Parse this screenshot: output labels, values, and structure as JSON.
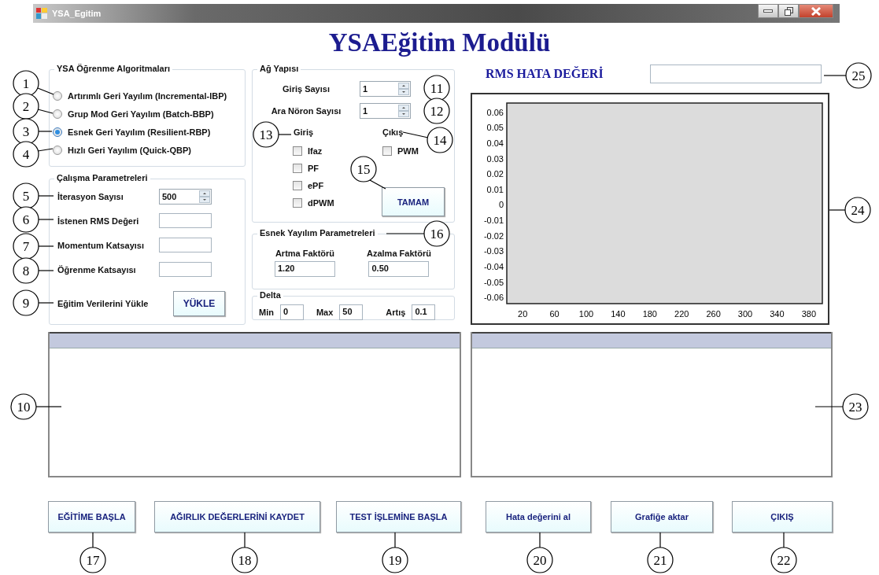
{
  "window": {
    "title": "YSA_Egitim"
  },
  "heading": "YSAEğitim Modülü",
  "algorithms": {
    "title": "YSA Öğrenme Algoritmaları",
    "options": [
      {
        "label": "Artırımlı Geri Yayılım (Incremental-IBP)",
        "selected": false
      },
      {
        "label": "Grup Mod Geri Yayılım (Batch-BBP)",
        "selected": false
      },
      {
        "label": "Esnek Geri Yayılım (Resilient-RBP)",
        "selected": true
      },
      {
        "label": "Hızlı Geri Yayılım (Quick-QBP)",
        "selected": false
      }
    ]
  },
  "parameters": {
    "title": "Çalışma Parametreleri",
    "rows": [
      {
        "kind": "spin",
        "label": "İterasyon Sayısı",
        "value": "500"
      },
      {
        "kind": "field",
        "label": "İstenen RMS Değeri"
      },
      {
        "kind": "field",
        "label": "Momentum Katsayısı"
      },
      {
        "kind": "field",
        "label": "Öğrenme Katsayısı"
      },
      {
        "kind": "button",
        "label": "Eğitim Verilerini Yükle",
        "button": "YÜKLE"
      }
    ]
  },
  "network": {
    "title": "Ağ Yapısı",
    "spins": [
      {
        "label": "Giriş Sayısı",
        "value": "1"
      },
      {
        "label": "Ara Nöron Sayısı",
        "value": "1"
      }
    ],
    "inputs": {
      "title": "Giriş",
      "options": [
        {
          "label": "Ifaz",
          "checked": false
        },
        {
          "label": "PF",
          "checked": false
        },
        {
          "label": "ePF",
          "checked": false
        },
        {
          "label": "dPWM",
          "checked": false
        }
      ]
    },
    "outputs": {
      "title": "Çıkış",
      "options": [
        {
          "label": "PWM",
          "checked": false
        }
      ]
    },
    "ok_button": "TAMAM"
  },
  "resilient": {
    "title": "Esnek Yayılım Parametreleri",
    "fields": [
      {
        "label": "Artma Faktörü",
        "value": "1.20"
      },
      {
        "label": "Azalma Faktörü",
        "value": "0.50"
      }
    ]
  },
  "delta": {
    "title": "Delta",
    "fields": [
      {
        "label": "Min",
        "value": "0"
      },
      {
        "label": "Max",
        "value": "50"
      },
      {
        "label": "Artış",
        "value": "0.1"
      }
    ]
  },
  "rms": {
    "label": "RMS HATA DEĞERİ"
  },
  "chart": {
    "chart_data": {
      "type": "line",
      "xlim": [
        0,
        397
      ],
      "ylim": [
        -0.064,
        0.066
      ],
      "xticks": [
        20,
        60,
        100,
        140,
        180,
        220,
        260,
        300,
        340,
        380
      ],
      "yticks": [
        0.06,
        0.05,
        0.04,
        0.03,
        0.02,
        0.01,
        0,
        -0.01,
        -0.02,
        -0.03,
        -0.04,
        -0.05,
        -0.06
      ]
    }
  },
  "buttons": [
    "EĞİTİME BAŞLA",
    "AĞIRLIK DEĞERLERİNİ KAYDET",
    "TEST İŞLEMİNE BAŞLA",
    "Hata değerini al",
    "Grafiğe aktar",
    "ÇIKIŞ"
  ],
  "callouts": [
    "25",
    "1",
    "11",
    "2",
    "12",
    "3",
    "13",
    "14",
    "4",
    "15",
    "5",
    "24",
    "6",
    "16",
    "7",
    "8",
    "9",
    "10",
    "23",
    "17",
    "18",
    "19",
    "20",
    "21",
    "22"
  ]
}
